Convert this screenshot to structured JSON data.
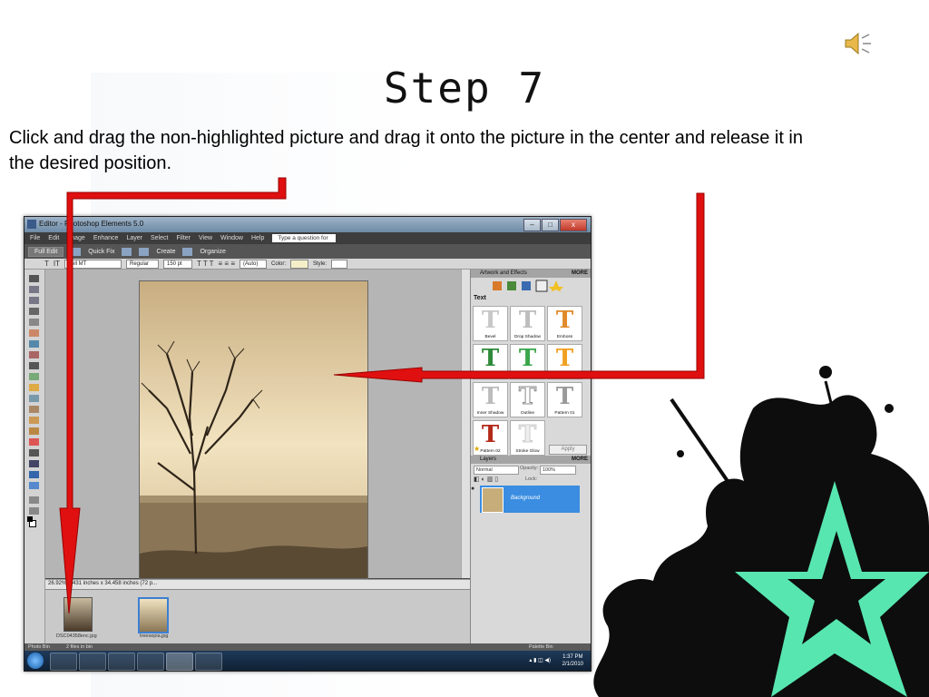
{
  "slide": {
    "title": "Step 7",
    "instructions": "Click and drag the non-highlighted picture and drag it onto the picture in the center and release it in the desired position."
  },
  "window": {
    "title": "Editor - Photoshop Elements 5.0",
    "controls": {
      "minimize": "–",
      "maximize": "□",
      "close": "x"
    }
  },
  "menu": {
    "items": [
      "File",
      "Edit",
      "Image",
      "Enhance",
      "Layer",
      "Select",
      "Filter",
      "View",
      "Window",
      "Help"
    ],
    "search_placeholder": "Type a question for help"
  },
  "modes": {
    "full_edit": "Full Edit",
    "quick_fix": "Quick Fix",
    "create": "Create",
    "organize": "Organize"
  },
  "options": {
    "font": "Bell MT",
    "style": "Regular",
    "size": "150 pt",
    "leading": "(Auto)",
    "color_label": "Color:",
    "style_label": "Style:"
  },
  "canvas": {
    "zoom": "26.92%",
    "doc_info": "431 inches x 34.458 inches (72 p..."
  },
  "bin": {
    "thumbs": [
      "DSC04358enc.jpg",
      "treesepia.jpg"
    ],
    "status": "Photo Bin",
    "files_info": "2 files in bin",
    "palette_bin": "Palette Bin"
  },
  "palettes": {
    "artwork_title": "Artwork and Effects",
    "more": "MORE",
    "category": "Text",
    "styles": [
      {
        "name": "Bevel",
        "color": "#c8c8c8"
      },
      {
        "name": "Drop Shadow",
        "color": "#bdbdbd"
      },
      {
        "name": "Emboss",
        "color": "#e08a2a"
      },
      {
        "name": "Gradient Stroke",
        "color": "#2f8a3a"
      },
      {
        "name": "Gradient",
        "color": "#3aa64a"
      },
      {
        "name": "Inner Glow",
        "color": "#f0a020"
      },
      {
        "name": "Inner Shadow",
        "color": "#bcbcbc"
      },
      {
        "name": "Outline",
        "color": "#f4f4f4"
      },
      {
        "name": "Pattern 01",
        "color": "#9a9a9a"
      },
      {
        "name": "Pattern 02",
        "color": "#b32a1a"
      },
      {
        "name": "Stroke Glow",
        "color": "#eeeeee"
      }
    ],
    "apply": "Apply",
    "layers_title": "Layers",
    "blend_mode": "Normal",
    "opacity_label": "Opacity:",
    "opacity": "100%",
    "lock_label": "Lock:",
    "layer_name": "Background"
  },
  "taskbar": {
    "time": "1:37 PM",
    "date": "2/1/2010"
  },
  "colors": {
    "arrow": "#e01010",
    "accent": "#3a8de0",
    "splat": "#58e6b0"
  }
}
